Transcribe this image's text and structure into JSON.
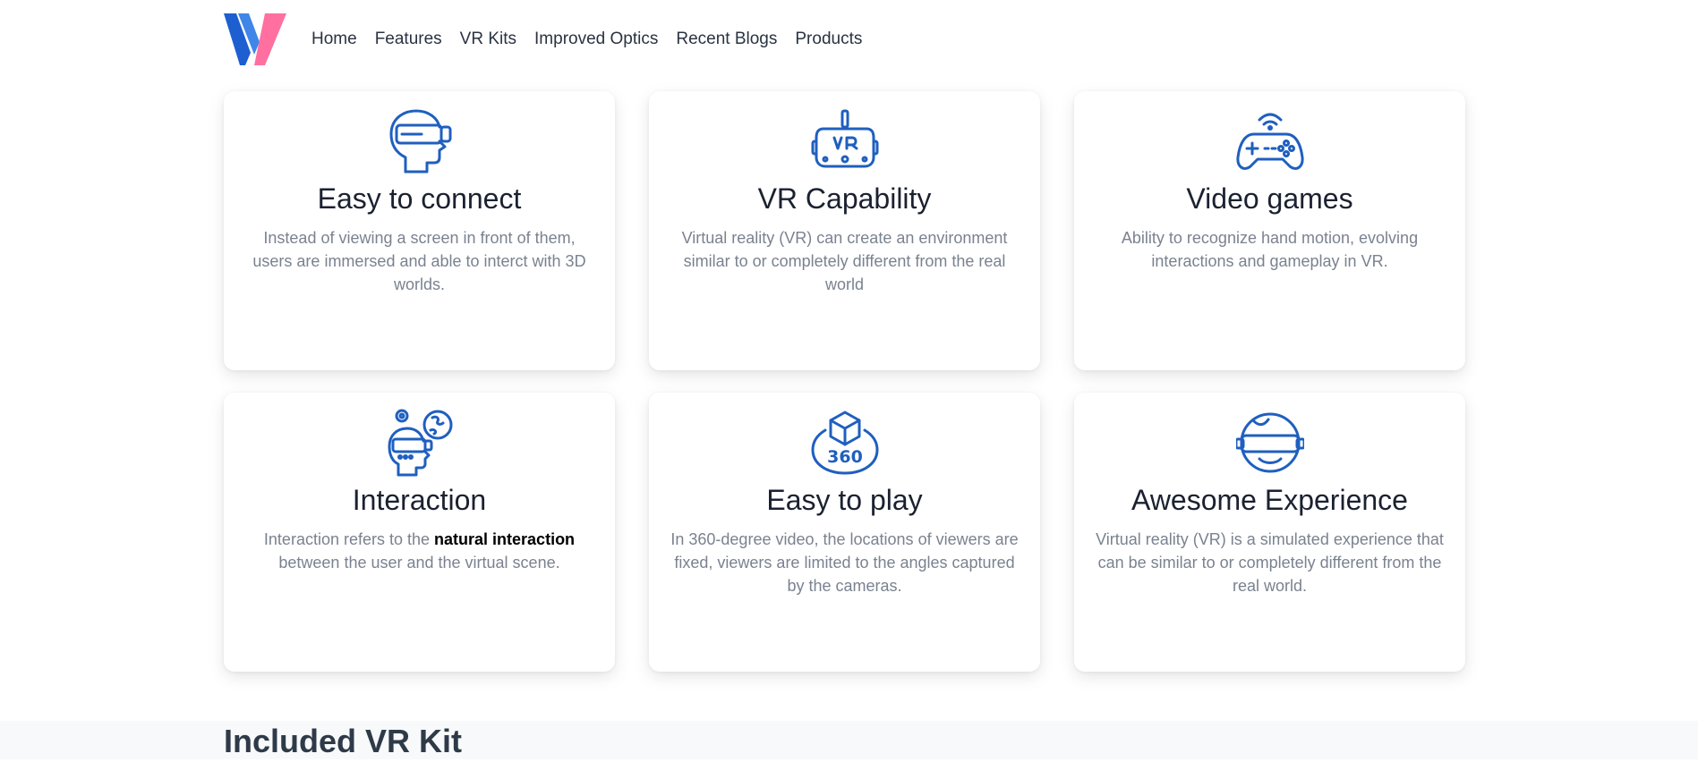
{
  "nav": {
    "logo": "VR logo",
    "links": [
      "Home",
      "Features",
      "VR Kits",
      "Improved Optics",
      "Recent Blogs",
      "Products"
    ]
  },
  "colors": {
    "icon_blue": "#1f5fbf",
    "logo_blue": "#1d5fd0",
    "logo_pink": "#ff6fa0",
    "desc_gray": "#7a8290"
  },
  "features": [
    {
      "icon": "vr-headset-head-icon",
      "title": "Easy to connect",
      "desc": "Instead of viewing a screen in front of them, users are immersed and able to interct with 3D worlds."
    },
    {
      "icon": "vr-headset-icon",
      "title": "VR Capability",
      "desc": "Virtual reality (VR) can create an environment similar to or completely different from the real world"
    },
    {
      "icon": "game-controller-icon",
      "title": "Video games",
      "desc": "Ability to recognize hand motion, evolving interactions and gameplay in VR."
    },
    {
      "icon": "vr-interaction-icon",
      "title": "Interaction",
      "desc_before": "Interaction refers to the ",
      "desc_bold": "natural interaction",
      "desc_after": " between the user and the virtual scene."
    },
    {
      "icon": "cube-360-icon",
      "title": "Easy to play",
      "desc": "In 360-degree video, the locations of viewers are fixed, viewers are limited to the angles captured by the cameras."
    },
    {
      "icon": "vr-face-icon",
      "title": "Awesome Experience",
      "desc": "Virtual reality (VR) is a simulated experience that can be similar to or completely different from the real world."
    }
  ],
  "kit": {
    "title": "Included VR Kit"
  }
}
